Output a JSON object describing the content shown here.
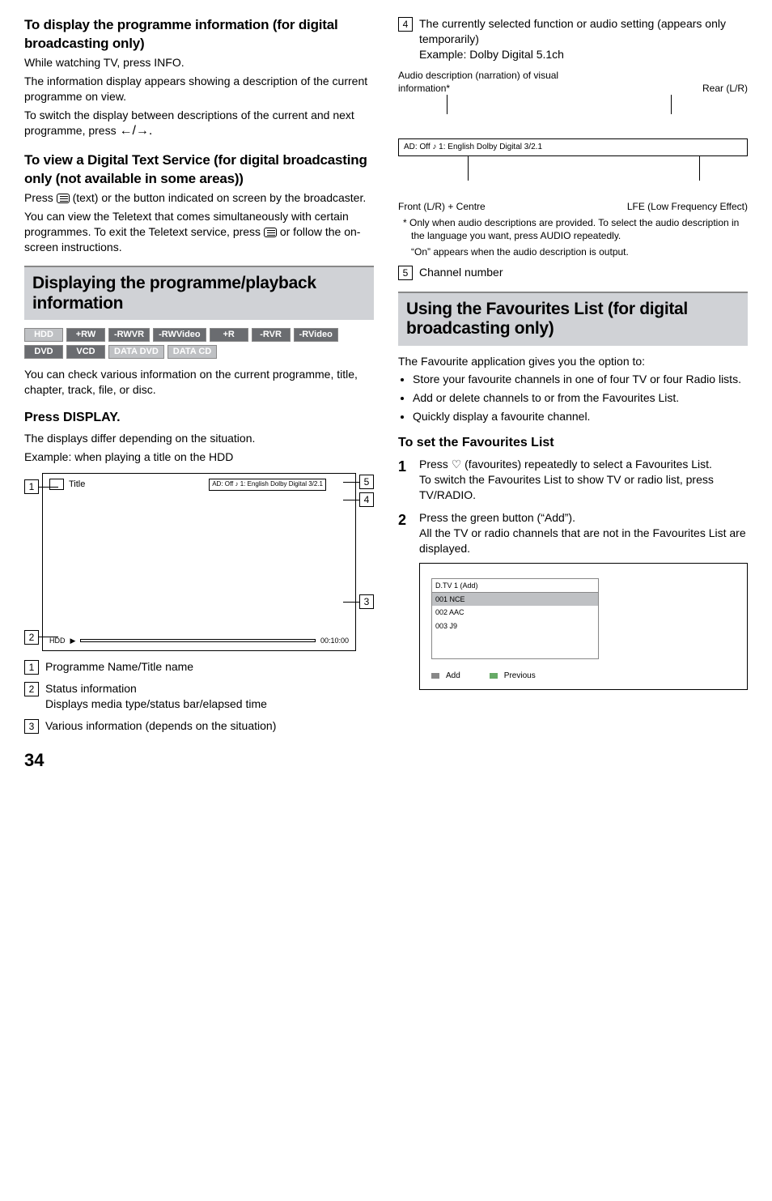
{
  "left": {
    "sec1_h": "To display the programme information (for digital broadcasting only)",
    "sec1_p1": "While watching TV, press INFO.",
    "sec1_p2": "The information display appears showing a description of the current programme on view.",
    "sec1_p3": "To switch the display between descriptions of the current and next programme, press",
    "sec1_arrows": "←/→.",
    "sec2_h": "To view a Digital Text Service (for digital broadcasting only (not available in some areas))",
    "sec2_p1a": "Press ",
    "sec2_p1b": " (text) or the button indicated on screen by the broadcaster.",
    "sec2_p2a": "You can view the Teletext that comes simultaneously with certain programmes. To exit the Teletext service, press ",
    "sec2_p2b": " or follow the on-screen instructions.",
    "banner1": "Displaying the programme/playback information",
    "badges": [
      "HDD",
      "+RW",
      "-RWVR",
      "-RWVideo",
      "+R",
      "-RVR",
      "-RVideo",
      "DVD",
      "VCD",
      "DATA DVD",
      "DATA CD"
    ],
    "after_badges": "You can check various information on the current programme, title, chapter, track, file, or disc.",
    "action_h": "Press DISPLAY.",
    "action_p1": "The displays differ depending on the situation.",
    "action_p2": "Example: when playing a title on the HDD",
    "diag_title_label": "Title",
    "diag_audio": "AD: Off   ♪ 1: English  Dolby Digital 3/2.1",
    "diag_hdd": "HDD",
    "diag_play": "▶",
    "diag_time": "00:10:00",
    "items": {
      "i1": "Programme Name/Title name",
      "i2": "Status information",
      "i2b": "Displays media type/status bar/elapsed time",
      "i3": "Various information (depends on the situation)"
    }
  },
  "right": {
    "i4": "The currently selected function or audio setting (appears only temporarily)",
    "i4b": "Example: Dolby Digital 5.1ch",
    "dolby_tl": "Audio description (narration) of visual information*",
    "dolby_tr": "Rear (L/R)",
    "dolby_box": "AD: Off   ♪ 1: English  Dolby Digital 3/2.1",
    "dolby_bl": "Front (L/R) + Centre",
    "dolby_br": "LFE (Low Frequency Effect)",
    "fn1": "* Only when audio descriptions are provided. To select the audio description in the language you want, press AUDIO repeatedly.",
    "fn2": "“On” appears when the audio description is output.",
    "i5": "Channel number",
    "banner2": "Using the Favourites List (for digital broadcasting only)",
    "p_after": "The Favourite application gives you the option to:",
    "bul1": "Store your favourite channels in one of four TV or four Radio lists.",
    "bul2": "Add or delete channels to or from the Favourites List.",
    "bul3": "Quickly display a favourite channel.",
    "sub2": "To set the Favourites List",
    "s1a": "Press ",
    "s1b": " (favourites) repeatedly to select a Favourites List.",
    "s1c": "To switch the Favourites List to show TV or radio list, press TV/RADIO.",
    "s2a": "Press the green button (“Add”).",
    "s2b": "All the TV or radio channels that are not in the Favourites List are displayed.",
    "fav": {
      "head": "D.TV 1 (Add)",
      "r1": "001 NCE",
      "r2": "002 AAC",
      "r3": "003 J9",
      "add": "Add",
      "prev": "Previous"
    }
  },
  "page_number": "34"
}
